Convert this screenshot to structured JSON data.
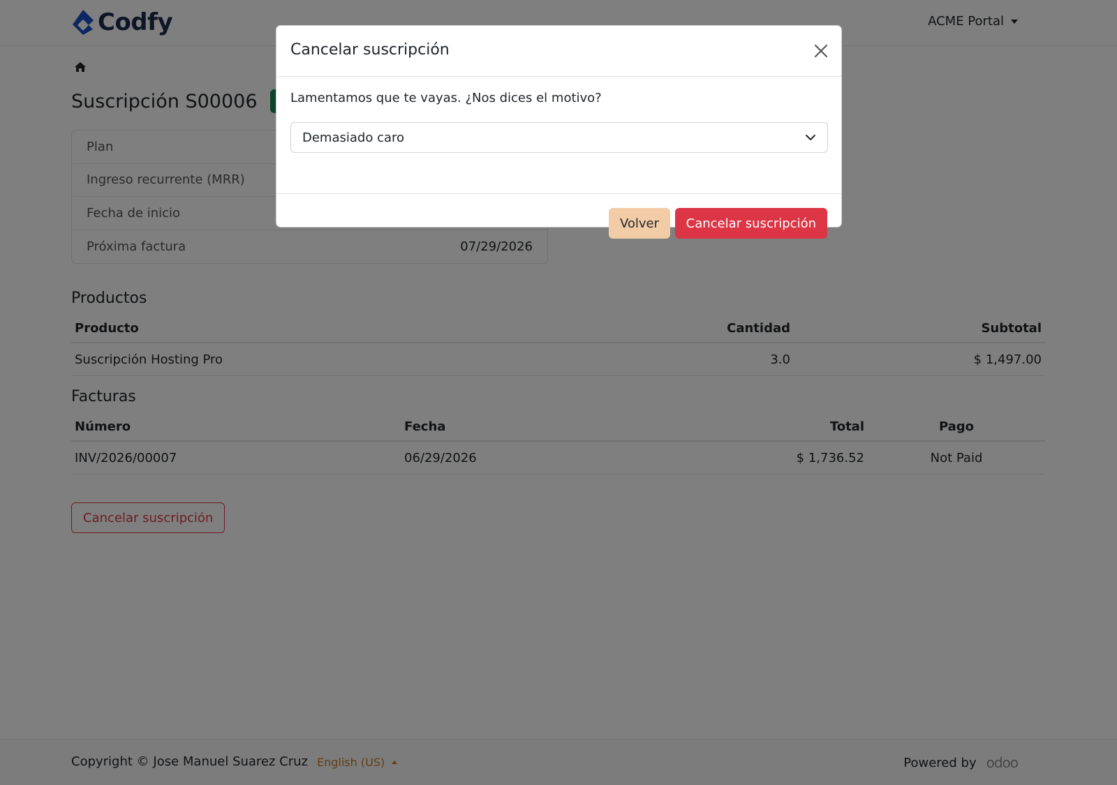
{
  "header": {
    "brand": "Codfy",
    "portal_menu": "ACME Portal"
  },
  "breadcrumb": {
    "icon": "home-icon"
  },
  "subscription": {
    "title": "Suscripción S00006",
    "status": "",
    "info": [
      {
        "label": "Plan",
        "value": ""
      },
      {
        "label": "Ingreso recurrente (MRR)",
        "value": ""
      },
      {
        "label": "Fecha de inicio",
        "value": ""
      },
      {
        "label": "Próxima factura",
        "value": "07/29/2026"
      }
    ]
  },
  "products": {
    "title": "Productos",
    "headers": {
      "product": "Producto",
      "quantity": "Cantidad",
      "subtotal": "Subtotal"
    },
    "rows": [
      {
        "product": "Suscripción Hosting Pro",
        "quantity": "3.0",
        "subtotal": "$ 1,497.00"
      }
    ]
  },
  "invoices": {
    "title": "Facturas",
    "headers": {
      "number": "Número",
      "date": "Fecha",
      "total": "Total",
      "payment": "Pago"
    },
    "rows": [
      {
        "number": "INV/2026/00007",
        "date": "06/29/2026",
        "total": "$ 1,736.52",
        "payment": "Not Paid"
      }
    ]
  },
  "cancel_button_label": "Cancelar suscripción",
  "footer": {
    "copyright": "Copyright © Jose Manuel Suarez Cruz",
    "language": "English (US)",
    "powered_by": "Powered by",
    "powered_brand": "odoo"
  },
  "modal": {
    "title": "Cancelar suscripción",
    "prompt": "Lamentamos que te vayas. ¿Nos dices el motivo?",
    "selected_reason": "Demasiado caro",
    "back_label": "Volver",
    "confirm_label": "Cancelar suscripción"
  },
  "colors": {
    "danger": "#dc3545",
    "success": "#198754",
    "brand": "#1a4fc4",
    "back_button": "#f2cca7"
  }
}
